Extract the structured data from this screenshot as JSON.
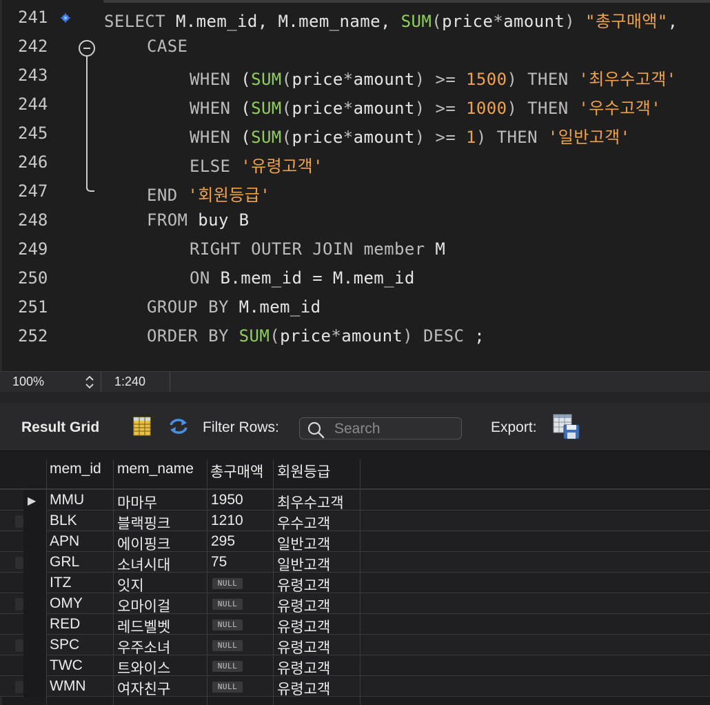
{
  "editor": {
    "lines": [
      {
        "n": "241",
        "indent": 0,
        "tokens": [
          [
            "kw",
            "SELECT"
          ],
          [
            "t",
            " M.mem_id, M.mem_name, "
          ],
          [
            "fn",
            "SUM"
          ],
          [
            "pn",
            "("
          ],
          [
            "t",
            "price"
          ],
          [
            "op",
            "*"
          ],
          [
            "t",
            "amount"
          ],
          [
            "pn",
            ")"
          ],
          [
            "t",
            " "
          ],
          [
            "str",
            "\"총구매액\""
          ],
          [
            "t",
            ","
          ]
        ]
      },
      {
        "n": "242",
        "indent": 1,
        "tokens": [
          [
            "kw",
            "CASE"
          ]
        ]
      },
      {
        "n": "243",
        "indent": 2,
        "tokens": [
          [
            "kw",
            "WHEN"
          ],
          [
            "t",
            " ("
          ],
          [
            "fn",
            "SUM"
          ],
          [
            "pn",
            "("
          ],
          [
            "t",
            "price"
          ],
          [
            "op",
            "*"
          ],
          [
            "t",
            "amount"
          ],
          [
            "pn",
            ")"
          ],
          [
            "t",
            " "
          ],
          [
            "op",
            ">="
          ],
          [
            "t",
            " "
          ],
          [
            "num",
            "1500"
          ],
          [
            "pn",
            ")"
          ],
          [
            "t",
            " "
          ],
          [
            "kw",
            "THEN"
          ],
          [
            "t",
            " "
          ],
          [
            "str",
            "'최우수고객'"
          ]
        ]
      },
      {
        "n": "244",
        "indent": 2,
        "tokens": [
          [
            "kw",
            "WHEN"
          ],
          [
            "t",
            " ("
          ],
          [
            "fn",
            "SUM"
          ],
          [
            "pn",
            "("
          ],
          [
            "t",
            "price"
          ],
          [
            "op",
            "*"
          ],
          [
            "t",
            "amount"
          ],
          [
            "pn",
            ")"
          ],
          [
            "t",
            " "
          ],
          [
            "op",
            ">="
          ],
          [
            "t",
            " "
          ],
          [
            "num",
            "1000"
          ],
          [
            "pn",
            ")"
          ],
          [
            "t",
            " "
          ],
          [
            "kw",
            "THEN"
          ],
          [
            "t",
            " "
          ],
          [
            "str",
            "'우수고객'"
          ]
        ]
      },
      {
        "n": "245",
        "indent": 2,
        "tokens": [
          [
            "kw",
            "WHEN"
          ],
          [
            "t",
            " ("
          ],
          [
            "fn",
            "SUM"
          ],
          [
            "pn",
            "("
          ],
          [
            "t",
            "price"
          ],
          [
            "op",
            "*"
          ],
          [
            "t",
            "amount"
          ],
          [
            "pn",
            ")"
          ],
          [
            "t",
            " "
          ],
          [
            "op",
            ">="
          ],
          [
            "t",
            " "
          ],
          [
            "num",
            "1"
          ],
          [
            "pn",
            ")"
          ],
          [
            "t",
            " "
          ],
          [
            "kw",
            "THEN"
          ],
          [
            "t",
            " "
          ],
          [
            "str",
            "'일반고객'"
          ]
        ]
      },
      {
        "n": "246",
        "indent": 2,
        "tokens": [
          [
            "kw",
            "ELSE"
          ],
          [
            "t",
            " "
          ],
          [
            "str",
            "'유령고객'"
          ]
        ]
      },
      {
        "n": "247",
        "indent": 1,
        "tokens": [
          [
            "kw",
            "END"
          ],
          [
            "t",
            " "
          ],
          [
            "str",
            "'회원등급'"
          ]
        ]
      },
      {
        "n": "248",
        "indent": 1,
        "tokens": [
          [
            "kw",
            "FROM"
          ],
          [
            "t",
            " buy B"
          ]
        ]
      },
      {
        "n": "249",
        "indent": 2,
        "tokens": [
          [
            "kw",
            "RIGHT OUTER JOIN"
          ],
          [
            "t",
            " "
          ],
          [
            "kw",
            "member"
          ],
          [
            "t",
            " M"
          ]
        ]
      },
      {
        "n": "250",
        "indent": 2,
        "tokens": [
          [
            "kw",
            "ON"
          ],
          [
            "t",
            " B.mem_id = M.mem_id"
          ]
        ]
      },
      {
        "n": "251",
        "indent": 1,
        "tokens": [
          [
            "kw",
            "GROUP BY"
          ],
          [
            "t",
            " M.mem_id"
          ]
        ]
      },
      {
        "n": "252",
        "indent": 1,
        "tokens": [
          [
            "kw",
            "ORDER BY"
          ],
          [
            "t",
            " "
          ],
          [
            "fn",
            "SUM"
          ],
          [
            "pn",
            "("
          ],
          [
            "t",
            "price"
          ],
          [
            "op",
            "*"
          ],
          [
            "t",
            "amount"
          ],
          [
            "pn",
            ")"
          ],
          [
            "t",
            " "
          ],
          [
            "kw",
            "DESC"
          ],
          [
            "t",
            " ;"
          ]
        ]
      }
    ]
  },
  "statusbar": {
    "zoom": "100%",
    "cursor_position": "1:240"
  },
  "toolbar": {
    "result_grid_label": "Result Grid",
    "filter_rows_label": "Filter Rows:",
    "search_placeholder": "Search",
    "export_label": "Export:"
  },
  "grid": {
    "columns": [
      "mem_id",
      "mem_name",
      "총구매액",
      "회원등급"
    ],
    "null_label": "NULL",
    "current_row_indicator": "▶",
    "rows": [
      [
        "MMU",
        "마마무",
        "1950",
        "최우수고객"
      ],
      [
        "BLK",
        "블랙핑크",
        "1210",
        "우수고객"
      ],
      [
        "APN",
        "에이핑크",
        "295",
        "일반고객"
      ],
      [
        "GRL",
        "소녀시대",
        "75",
        "일반고객"
      ],
      [
        "ITZ",
        "잇지",
        null,
        "유령고객"
      ],
      [
        "OMY",
        "오마이걸",
        null,
        "유령고객"
      ],
      [
        "RED",
        "레드벨벳",
        null,
        "유령고객"
      ],
      [
        "SPC",
        "우주소녀",
        null,
        "유령고객"
      ],
      [
        "TWC",
        "트와이스",
        null,
        "유령고객"
      ],
      [
        "WMN",
        "여자친구",
        null,
        "유령고객"
      ]
    ]
  },
  "colors": {
    "keyword": "#bcbcbc",
    "function": "#8fcf5a",
    "literal": "#f0a24a",
    "background": "#1e1e1f"
  }
}
